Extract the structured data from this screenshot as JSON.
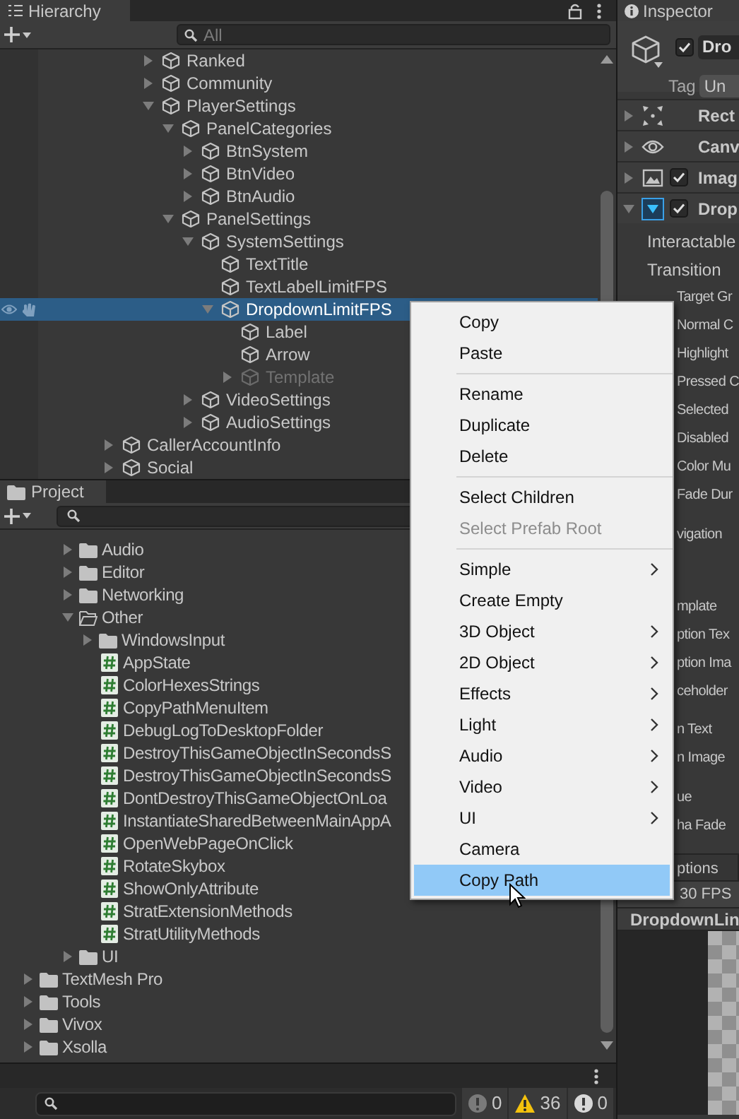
{
  "hierarchy": {
    "title": "Hierarchy",
    "search": {
      "placeholder": "All"
    },
    "items": [
      {
        "children": [
          {
            "children": [
              {
                "name": "Ranked",
                "expanded": false,
                "active": true,
                "selected": false
              },
              {
                "name": "Community",
                "expanded": false,
                "active": true,
                "selected": false
              },
              {
                "name": "PlayerSettings",
                "expanded": true,
                "active": true,
                "selected": false,
                "children": [
                  {
                    "name": "PanelCategories",
                    "expanded": true,
                    "active": true,
                    "selected": false,
                    "children": [
                      {
                        "name": "BtnSystem",
                        "expanded": false,
                        "active": true,
                        "selected": false
                      },
                      {
                        "name": "BtnVideo",
                        "expanded": false,
                        "active": true,
                        "selected": false
                      },
                      {
                        "name": "BtnAudio",
                        "expanded": false,
                        "active": true,
                        "selected": false
                      }
                    ]
                  },
                  {
                    "name": "PanelSettings",
                    "expanded": true,
                    "active": true,
                    "selected": false,
                    "children": [
                      {
                        "name": "SystemSettings",
                        "expanded": true,
                        "active": true,
                        "selected": false,
                        "children": [
                          {
                            "name": "TextTitle",
                            "active": true,
                            "selected": false
                          },
                          {
                            "name": "TextLabelLimitFPS",
                            "active": true,
                            "selected": false
                          },
                          {
                            "name": "DropdownLimitFPS",
                            "expanded": true,
                            "active": true,
                            "selected": true,
                            "children": [
                              {
                                "name": "Label",
                                "active": true,
                                "selected": false
                              },
                              {
                                "name": "Arrow",
                                "active": true,
                                "selected": false
                              },
                              {
                                "name": "Template",
                                "expanded": false,
                                "active": false,
                                "selected": false
                              }
                            ]
                          }
                        ]
                      },
                      {
                        "name": "VideoSettings",
                        "expanded": false,
                        "active": true,
                        "selected": false
                      },
                      {
                        "name": "AudioSettings",
                        "expanded": false,
                        "active": true,
                        "selected": false
                      }
                    ]
                  }
                ]
              }
            ]
          }
        ]
      },
      {
        "name": "CallerAccountInfo",
        "expanded": false,
        "active": true,
        "selected": false
      },
      {
        "name": "Social",
        "expanded": false,
        "active": true,
        "selected": false
      }
    ]
  },
  "project": {
    "title": "Project",
    "items": [
      {
        "children": [
          {
            "children": [
              {
                "kind": "folder",
                "name": "Audio",
                "expanded": false
              },
              {
                "kind": "folder",
                "name": "Editor",
                "expanded": false
              },
              {
                "kind": "folder",
                "name": "Networking",
                "expanded": false
              },
              {
                "kind": "folder",
                "name": "Other",
                "expanded": true,
                "children": [
                  {
                    "kind": "folder",
                    "name": "WindowsInput",
                    "expanded": false
                  },
                  {
                    "kind": "script",
                    "name": "AppState"
                  },
                  {
                    "kind": "script",
                    "name": "ColorHexesStrings"
                  },
                  {
                    "kind": "script",
                    "name": "CopyPathMenuItem"
                  },
                  {
                    "kind": "script",
                    "name": "DebugLogToDesktopFolder"
                  },
                  {
                    "kind": "script",
                    "name": "DestroyThisGameObjectInSecondsS"
                  },
                  {
                    "kind": "script",
                    "name": "DestroyThisGameObjectInSecondsS"
                  },
                  {
                    "kind": "script",
                    "name": "DontDestroyThisGameObjectOnLoa"
                  },
                  {
                    "kind": "script",
                    "name": "InstantiateSharedBetweenMainAppA"
                  },
                  {
                    "kind": "script",
                    "name": "OpenWebPageOnClick"
                  },
                  {
                    "kind": "script",
                    "name": "RotateSkybox"
                  },
                  {
                    "kind": "script",
                    "name": "ShowOnlyAttribute"
                  },
                  {
                    "kind": "script",
                    "name": "StratExtensionMethods"
                  },
                  {
                    "kind": "script",
                    "name": "StratUtilityMethods"
                  }
                ]
              },
              {
                "kind": "folder",
                "name": "UI",
                "expanded": false
              }
            ]
          }
        ]
      },
      {
        "kind": "folder",
        "name": "TextMesh Pro",
        "expanded": false
      },
      {
        "kind": "folder",
        "name": "Tools",
        "expanded": false
      },
      {
        "kind": "folder",
        "name": "Vivox",
        "expanded": false
      },
      {
        "kind": "folder",
        "name": "Xsolla",
        "expanded": false
      }
    ]
  },
  "console": {
    "counts": [
      {
        "kind": "info",
        "count": "0"
      },
      {
        "kind": "warning",
        "count": "36"
      },
      {
        "kind": "error",
        "count": "0"
      }
    ]
  },
  "inspector": {
    "title": "Inspector",
    "object": {
      "active": true,
      "name": "Dro",
      "tag_label": "Tag",
      "tag": "Un"
    },
    "components": [
      {
        "kind": "rect_transform",
        "name": "Rect",
        "expanded": false
      },
      {
        "kind": "canvas_renderer",
        "name": "Canv",
        "expanded": false
      },
      {
        "kind": "image",
        "name": "Imag",
        "expanded": false,
        "enabled": true
      },
      {
        "kind": "dropdown",
        "name": "Drop",
        "expanded": true,
        "enabled": true
      }
    ],
    "property_groups": [
      [
        {
          "kind": "row",
          "label": "Interactable"
        },
        {
          "kind": "row",
          "label": "Transition"
        },
        {
          "kind": "clipped",
          "label": "Target Gr"
        },
        {
          "kind": "clipped",
          "label": "Normal C"
        },
        {
          "kind": "clipped",
          "label": "Highlight"
        },
        {
          "kind": "clipped",
          "label": "Pressed C"
        },
        {
          "kind": "clipped",
          "label": "Selected"
        },
        {
          "kind": "clipped",
          "label": "Disabled"
        },
        {
          "kind": "clipped",
          "label": "Color Mu"
        },
        {
          "kind": "clipped",
          "label": "Fade Dur"
        }
      ],
      [
        {
          "kind": "clipped",
          "label": "vigation"
        }
      ],
      [
        {
          "kind": "clipped",
          "label": "mplate"
        },
        {
          "kind": "clipped",
          "label": "ption Tex"
        },
        {
          "kind": "clipped",
          "label": "ption Ima"
        },
        {
          "kind": "clipped",
          "label": "ceholder"
        }
      ],
      [
        {
          "kind": "clipped",
          "label": "n Text"
        },
        {
          "kind": "clipped",
          "label": "n Image"
        }
      ],
      [
        {
          "kind": "clipped",
          "label": "ue"
        },
        {
          "kind": "clipped",
          "label": "ha Fade"
        }
      ]
    ],
    "options": {
      "label": "ptions",
      "items": [
        "30 FPS"
      ]
    },
    "preview": {
      "title": "DropdownLin"
    }
  },
  "context_menu": {
    "items": [
      {
        "kind": "item",
        "label": "Copy",
        "disabled": false,
        "submenu": false,
        "selected": false
      },
      {
        "kind": "item",
        "label": "Paste",
        "disabled": false,
        "submenu": false,
        "selected": false
      },
      {
        "kind": "separator"
      },
      {
        "kind": "item",
        "label": "Rename",
        "disabled": false,
        "submenu": false,
        "selected": false
      },
      {
        "kind": "item",
        "label": "Duplicate",
        "disabled": false,
        "submenu": false,
        "selected": false
      },
      {
        "kind": "item",
        "label": "Delete",
        "disabled": false,
        "submenu": false,
        "selected": false
      },
      {
        "kind": "separator"
      },
      {
        "kind": "item",
        "label": "Select Children",
        "disabled": false,
        "submenu": false,
        "selected": false
      },
      {
        "kind": "item",
        "label": "Select Prefab Root",
        "disabled": true,
        "submenu": false,
        "selected": false
      },
      {
        "kind": "separator"
      },
      {
        "kind": "item",
        "label": "Simple",
        "disabled": false,
        "submenu": true,
        "selected": false
      },
      {
        "kind": "item",
        "label": "Create Empty",
        "disabled": false,
        "submenu": false,
        "selected": false
      },
      {
        "kind": "item",
        "label": "3D Object",
        "disabled": false,
        "submenu": true,
        "selected": false
      },
      {
        "kind": "item",
        "label": "2D Object",
        "disabled": false,
        "submenu": true,
        "selected": false
      },
      {
        "kind": "item",
        "label": "Effects",
        "disabled": false,
        "submenu": true,
        "selected": false
      },
      {
        "kind": "item",
        "label": "Light",
        "disabled": false,
        "submenu": true,
        "selected": false
      },
      {
        "kind": "item",
        "label": "Audio",
        "disabled": false,
        "submenu": true,
        "selected": false
      },
      {
        "kind": "item",
        "label": "Video",
        "disabled": false,
        "submenu": true,
        "selected": false
      },
      {
        "kind": "item",
        "label": "UI",
        "disabled": false,
        "submenu": true,
        "selected": false
      },
      {
        "kind": "item",
        "label": "Camera",
        "disabled": false,
        "submenu": false,
        "selected": false
      },
      {
        "kind": "item",
        "label": "Copy Path",
        "disabled": false,
        "submenu": false,
        "selected": true
      }
    ]
  }
}
